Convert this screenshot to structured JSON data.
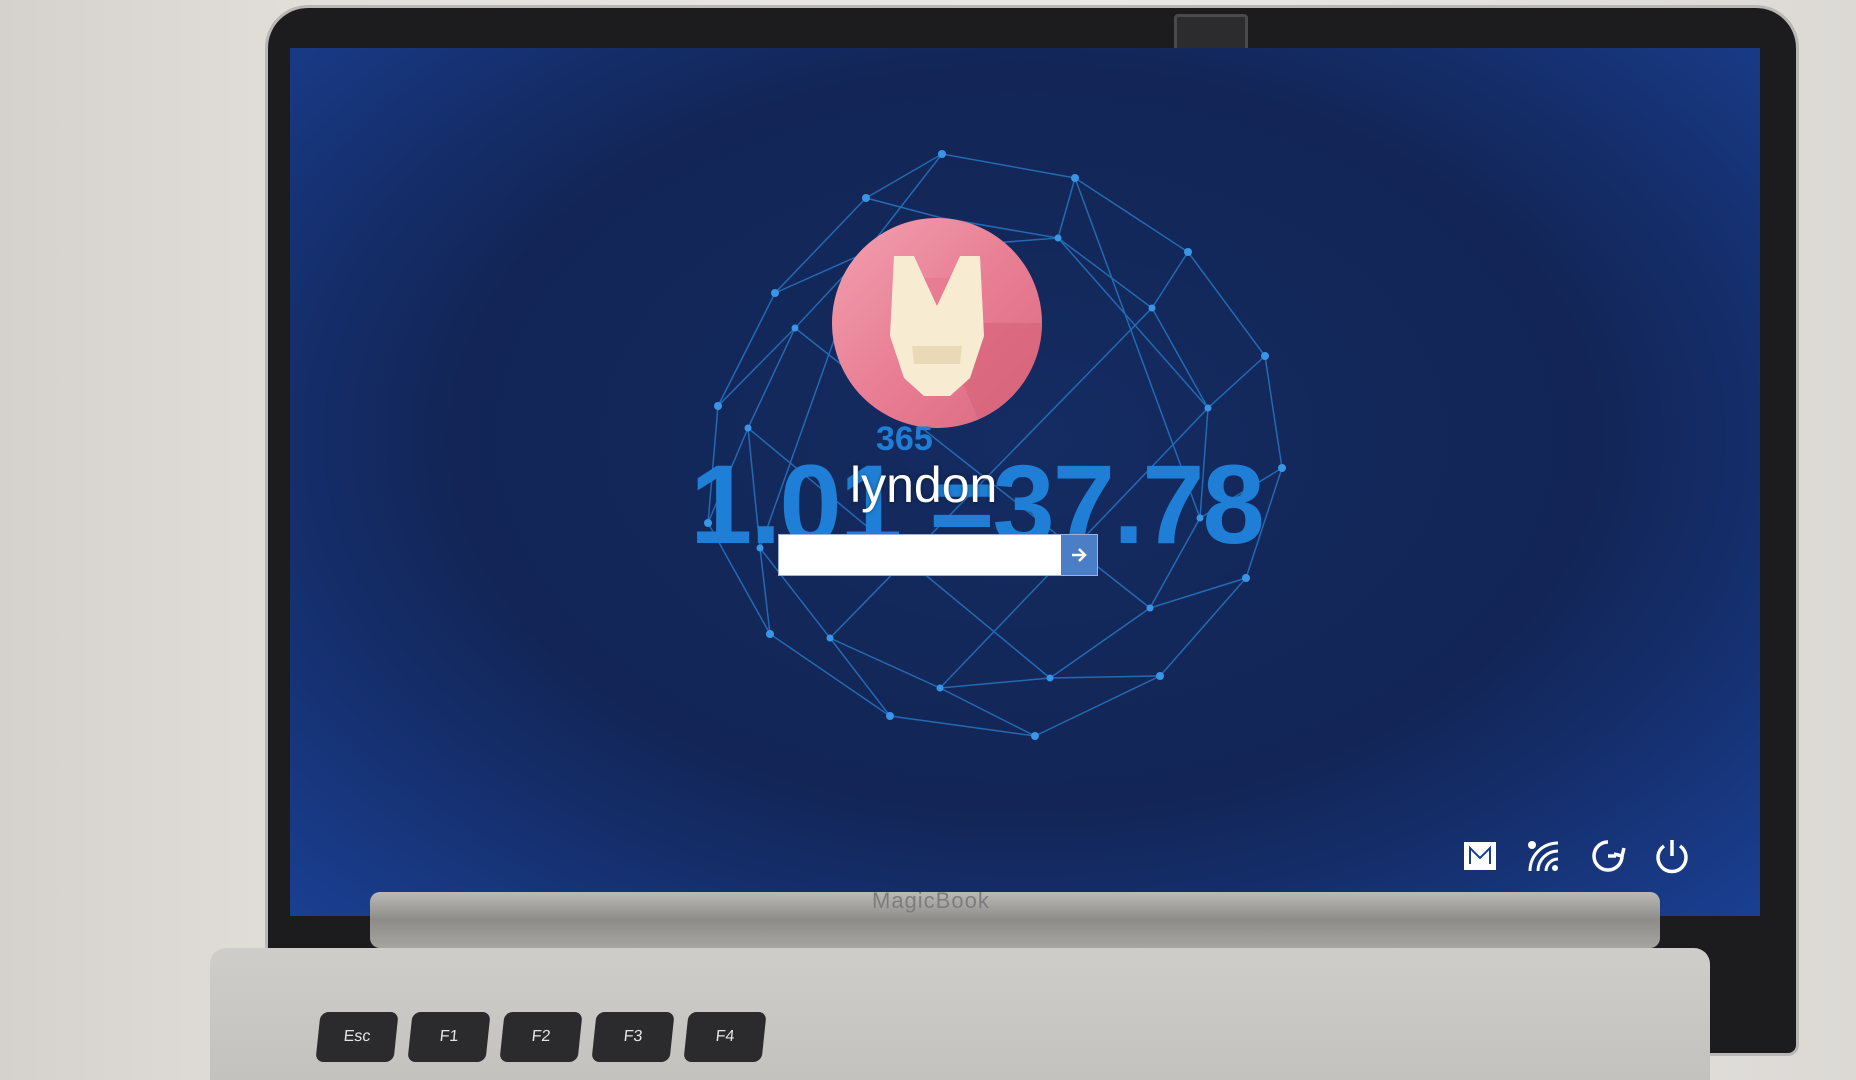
{
  "device": {
    "brand_label": "MagicBook"
  },
  "lock_screen": {
    "quote": {
      "superscript": "365",
      "main": "1.01 =37.78"
    },
    "user": {
      "name": "lyndon",
      "avatar_icon": "iron-man-helmet-icon"
    },
    "password": {
      "value": "",
      "placeholder": ""
    },
    "submit_icon": "arrow-right-icon",
    "tray": [
      {
        "name": "ease-of-access-icon"
      },
      {
        "name": "wifi-icon"
      },
      {
        "name": "accessibility-icon"
      },
      {
        "name": "power-icon"
      }
    ],
    "colors": {
      "background": "#13285a",
      "accent_text": "#1f7fd6",
      "avatar": "#e87c92",
      "submit_button": "#4a7fc8"
    }
  },
  "keyboard": {
    "keys": [
      "Esc",
      "F1",
      "F2",
      "F3",
      "F4"
    ]
  }
}
